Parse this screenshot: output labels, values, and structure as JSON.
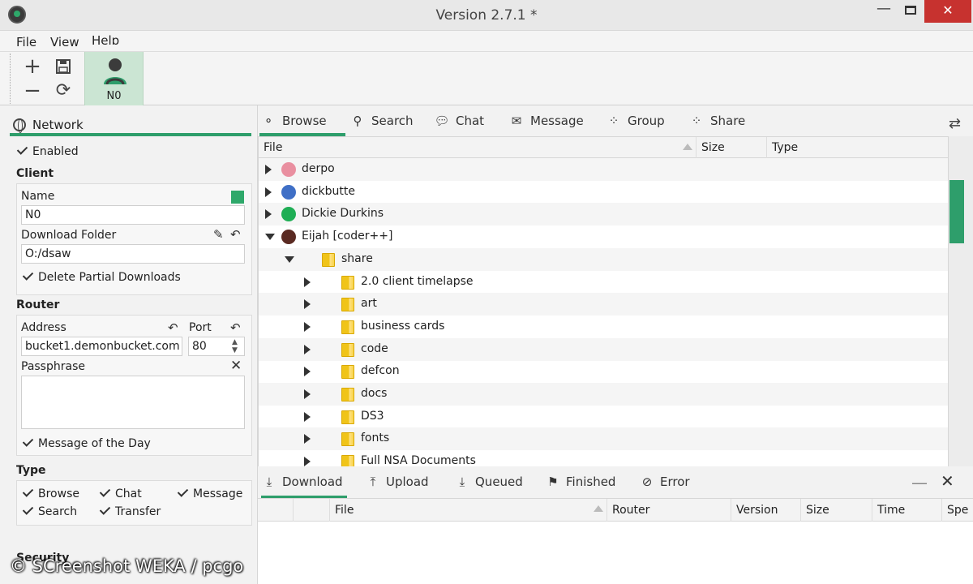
{
  "window": {
    "title": "Version 2.7.1 *",
    "min_glyph": "—",
    "close_glyph": "✕"
  },
  "menu": {
    "file": "File",
    "view": "View",
    "help": "Help"
  },
  "toolbar": {
    "node_label": "N0",
    "add_glyph": "+",
    "remove_glyph": "−",
    "save_glyph": "🖫",
    "refresh_glyph": "⟳"
  },
  "network": {
    "tab_label": "Network",
    "enabled_label": "Enabled",
    "client": {
      "header": "Client",
      "name_label": "Name",
      "name_value": "N0",
      "name_color": "#2ea86a",
      "folder_label": "Download Folder",
      "folder_value": "O:/dsaw",
      "delete_partial_label": "Delete Partial Downloads"
    },
    "router": {
      "header": "Router",
      "address_label": "Address",
      "address_value": "bucket1.demonbucket.com",
      "port_label": "Port",
      "port_value": "80",
      "passphrase_label": "Passphrase",
      "motd_label": "Message of the Day"
    },
    "type": {
      "header": "Type",
      "browse": "Browse",
      "chat": "Chat",
      "message": "Message",
      "search": "Search",
      "transfer": "Transfer"
    },
    "security_label": "Security"
  },
  "tabs": {
    "browse": "Browse",
    "search": "Search",
    "chat": "Chat",
    "message": "Message",
    "group": "Group",
    "share": "Share"
  },
  "file_table": {
    "headers": {
      "file": "File",
      "size": "Size",
      "type": "Type"
    },
    "peers": [
      {
        "name": "derpo",
        "color": "#e98fa0"
      },
      {
        "name": "dickbutte",
        "color": "#3f6fc6"
      },
      {
        "name": "Dickie Durkins",
        "color": "#1fae55"
      },
      {
        "name": "Eijah [coder++]",
        "color": "#5a2a22"
      }
    ],
    "share_folder": "share",
    "folders": [
      "2.0 client timelapse",
      "art",
      "business cards",
      "code",
      "defcon",
      "docs",
      "DS3",
      "fonts",
      "Full NSA Documents"
    ]
  },
  "bottom_tabs": {
    "download": "Download",
    "upload": "Upload",
    "queued": "Queued",
    "finished": "Finished",
    "error": "Error"
  },
  "transfer_table": {
    "headers": {
      "file": "File",
      "router": "Router",
      "version": "Version",
      "size": "Size",
      "time": "Time",
      "speed": "Spe"
    }
  },
  "watermark": "© SCreenshot WEKA / pcgo",
  "accent_color": "#2e9e6b"
}
